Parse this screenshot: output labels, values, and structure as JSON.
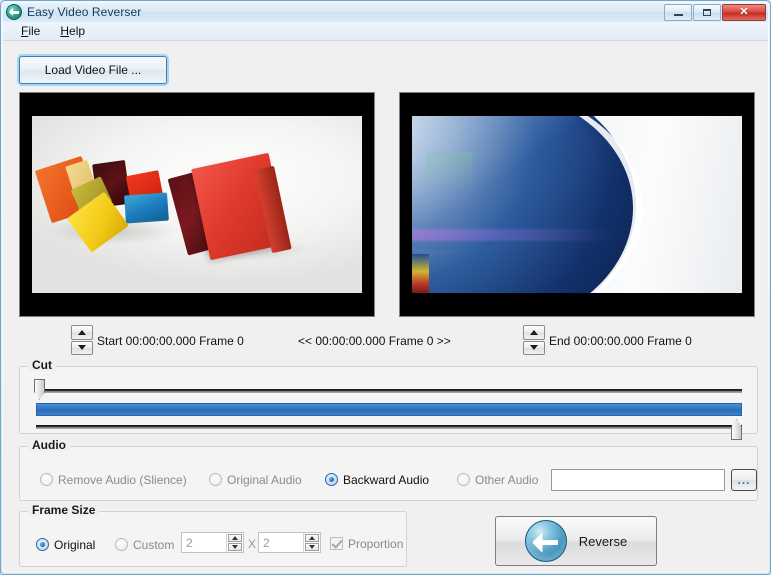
{
  "window": {
    "title": "Easy Video Reverser",
    "app_icon": "back-arrow-circle-icon",
    "controls": {
      "minimize": "minimize-icon",
      "maximize": "maximize-icon",
      "close": "✕"
    }
  },
  "menu": {
    "items": [
      {
        "label": "File",
        "accel": "F"
      },
      {
        "label": "Help",
        "accel": "H"
      }
    ]
  },
  "toolbar": {
    "load_label": "Load Video File ..."
  },
  "previews": {
    "left_name": "source-video-preview",
    "right_name": "reversed-video-preview"
  },
  "timeline": {
    "start_label": "Start 00:00:00.000  Frame 0",
    "center_label": "<< 00:00:00.000    Frame 0 >>",
    "end_label": "End 00:00:00.000  Frame 0",
    "start_time": "00:00:00.000",
    "start_frame": "Frame 0",
    "current_time": "00:00:00.000",
    "current_frame": "Frame 0",
    "end_time": "00:00:00.000",
    "end_frame": "Frame 0"
  },
  "cut": {
    "legend": "Cut",
    "start_thumb_percent": 0,
    "end_thumb_percent": 100,
    "selection_color": "#2f76c4"
  },
  "audio": {
    "legend": "Audio",
    "options": [
      {
        "label": "Remove Audio (Slience)",
        "checked": false
      },
      {
        "label": "Original Audio",
        "checked": false
      },
      {
        "label": "Backward Audio",
        "checked": true
      },
      {
        "label": "Other Audio",
        "checked": false
      }
    ],
    "other_path_value": "",
    "browse_label": "..."
  },
  "frame_size": {
    "legend": "Frame Size",
    "options": [
      {
        "label": "Original",
        "checked": true
      },
      {
        "label": "Custom",
        "checked": false
      }
    ],
    "width_value": "2",
    "height_value": "2",
    "separator": "X",
    "proportion_label": "Proportion",
    "proportion_checked": true,
    "proportion_disabled": true
  },
  "action": {
    "reverse_label": "Reverse",
    "reverse_icon": "reverse-arrow-circle-icon"
  }
}
